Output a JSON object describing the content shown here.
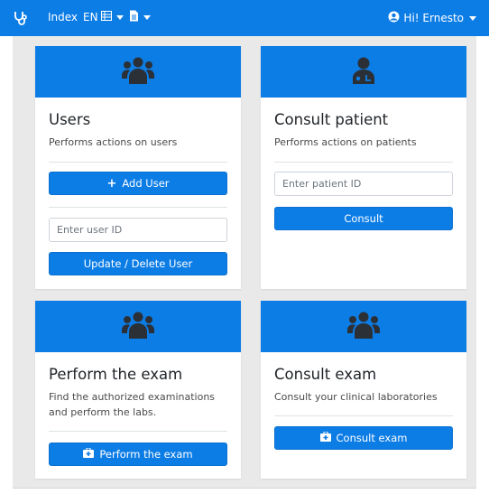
{
  "navbar": {
    "logo_icon": "stethoscope-icon",
    "index_label": "Index",
    "lang_label": "EN",
    "lang_icon": "flag-icon",
    "doc_icon": "document-icon",
    "user_icon": "user-circle-icon",
    "user_label": "Hi! Ernesto"
  },
  "cards": {
    "users": {
      "icon": "users-icon",
      "title": "Users",
      "text": "Performs actions on users",
      "add_button": "Add User",
      "input_placeholder": "Enter user ID",
      "update_button": "Update / Delete User"
    },
    "consult_patient": {
      "icon": "doctor-icon",
      "title": "Consult patient",
      "text": "Performs actions on patients",
      "input_placeholder": "Enter patient ID",
      "button": "Consult"
    },
    "perform_exam": {
      "icon": "users-icon",
      "title": "Perform the exam",
      "text": "Find the authorized examinations and perform the labs.",
      "button": "Perform the exam"
    },
    "consult_exam": {
      "icon": "users-icon",
      "title": "Consult exam",
      "text": "Consult your clinical laboratories",
      "button": "Consult exam"
    }
  },
  "colors": {
    "primary": "#0d7de6",
    "background": "#e9e9e9",
    "icon_dark": "#2b3036"
  }
}
